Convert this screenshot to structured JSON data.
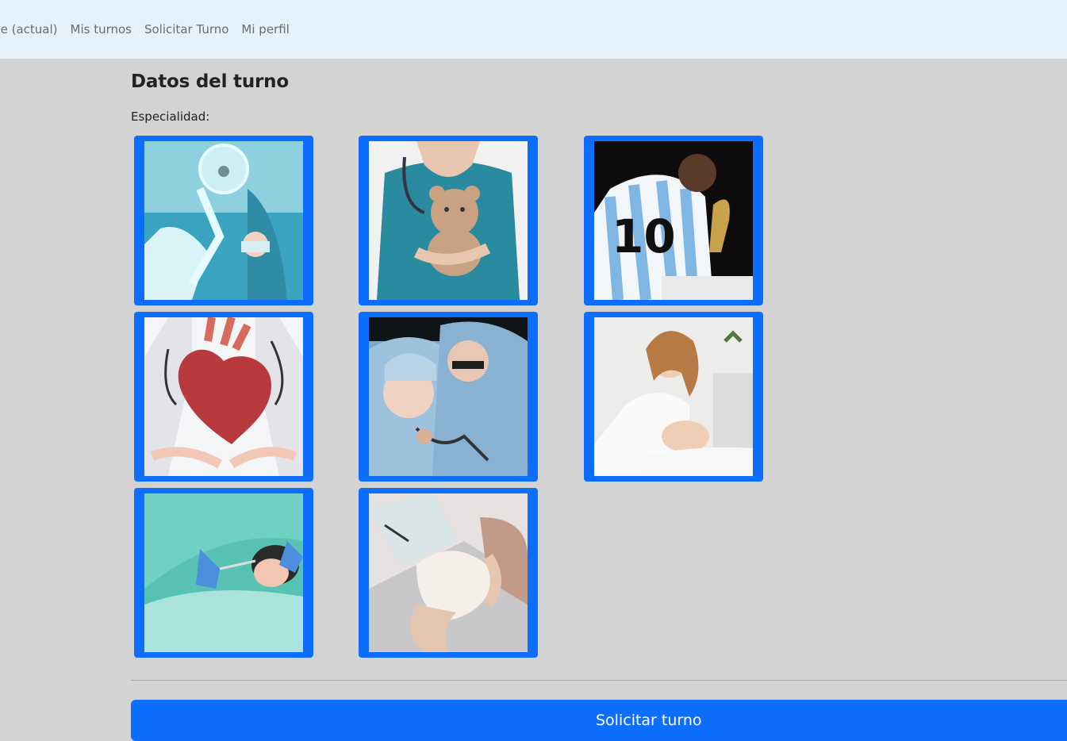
{
  "nav": {
    "items": [
      "me (actual)",
      "Mis turnos",
      "Solicitar Turno",
      "Mi perfil"
    ]
  },
  "form": {
    "title": "Datos del turno",
    "specialty_label": "Especialidad:",
    "submit_label": "Solicitar turno"
  },
  "specialty_images": [
    "anesthesia-mask-image",
    "pediatric-doctor-teddy-image",
    "soccer-player-trophy-image",
    "cardiology-heart-image",
    "surgery-team-image",
    "dermatology-facial-image",
    "dentistry-image",
    "knee-bandage-image"
  ],
  "colors": {
    "navbar_bg": "#e3f2fd",
    "page_bg": "#d3d3d3",
    "accent": "#0d6efd"
  }
}
